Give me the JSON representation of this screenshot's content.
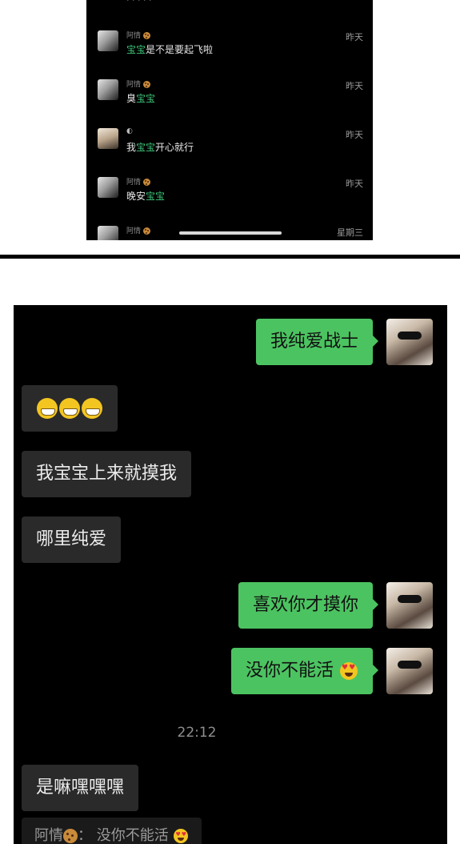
{
  "chat_list": {
    "rows": [
      {
        "name": "阿情",
        "time": "昨天",
        "preview_hl": "宝宝",
        "preview_rest": "是不是要起飞啦",
        "preview_pre": ""
      },
      {
        "name": "阿情",
        "time": "昨天",
        "preview_pre": "臭",
        "preview_hl": "宝宝",
        "preview_rest": ""
      },
      {
        "name": "",
        "time": "昨天",
        "preview_pre": "我",
        "preview_hl": "宝宝",
        "preview_rest": "开心就行"
      },
      {
        "name": "阿情",
        "time": "昨天",
        "preview_pre": "晚安",
        "preview_hl": "宝宝",
        "preview_rest": ""
      },
      {
        "name": "阿情",
        "time": "星期三",
        "preview_pre": "",
        "preview_hl": "",
        "preview_rest": ""
      }
    ],
    "colors": {
      "highlight": "#3ec77a",
      "background": "#000000"
    }
  },
  "conversation": {
    "messages": [
      {
        "direction": "outgoing",
        "text": "我纯爱战士"
      },
      {
        "direction": "incoming",
        "text": "",
        "emojis": [
          "grinning-face",
          "grinning-face",
          "grinning-face"
        ]
      },
      {
        "direction": "incoming",
        "text": "我宝宝上来就摸我"
      },
      {
        "direction": "incoming",
        "text": "哪里纯爱"
      },
      {
        "direction": "outgoing",
        "text": "喜欢你才摸你"
      },
      {
        "direction": "outgoing",
        "text": "没你不能活",
        "emojis": [
          "heart-eyes-face"
        ]
      },
      {
        "direction": "incoming",
        "text": "是嘛嘿嘿嘿"
      }
    ],
    "timestamp": "22:12",
    "quote": {
      "name": "阿情",
      "separator": "：",
      "text": "没你不能活"
    },
    "colors": {
      "outgoing_bubble": "#4cc361",
      "incoming_bubble": "#2a2a2a",
      "background": "#000000"
    }
  }
}
